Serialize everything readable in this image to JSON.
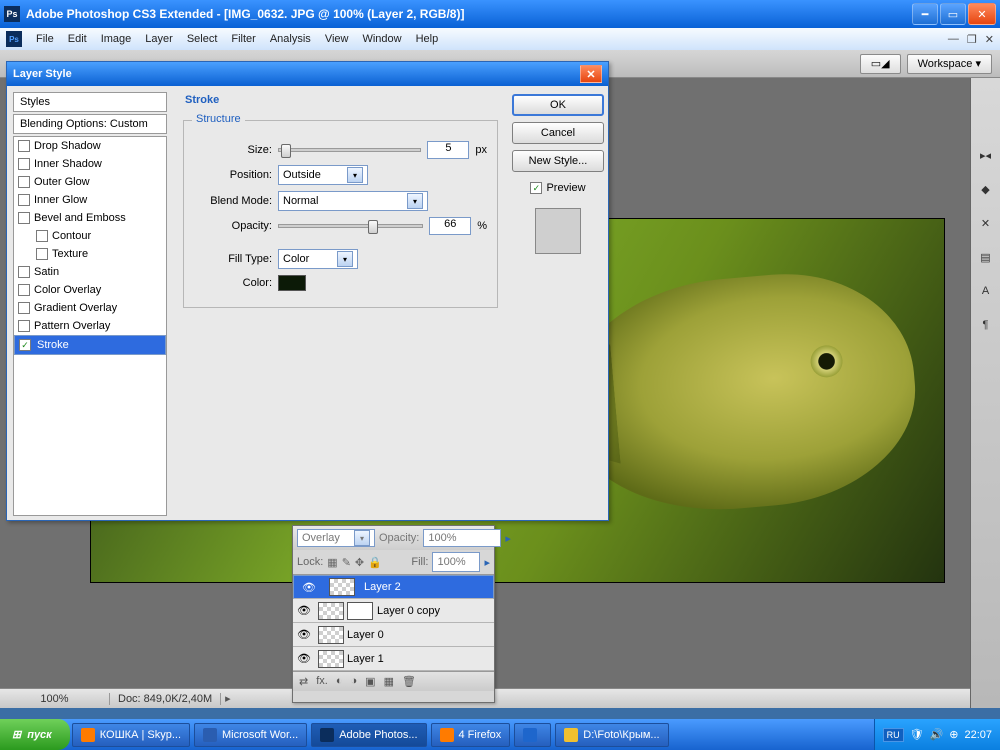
{
  "title": "Adobe Photoshop CS3 Extended - [IMG_0632. JPG @ 100% (Layer 2, RGB/8)]",
  "menu": [
    "File",
    "Edit",
    "Image",
    "Layer",
    "Select",
    "Filter",
    "Analysis",
    "View",
    "Window",
    "Help"
  ],
  "workspace_btn": "Workspace ▾",
  "dialog": {
    "title": "Layer Style",
    "styles_header": "Styles",
    "blending": "Blending Options: Custom",
    "items": [
      {
        "label": "Drop Shadow",
        "checked": false
      },
      {
        "label": "Inner Shadow",
        "checked": false
      },
      {
        "label": "Outer Glow",
        "checked": false
      },
      {
        "label": "Inner Glow",
        "checked": false
      },
      {
        "label": "Bevel and Emboss",
        "checked": false
      },
      {
        "label": "Contour",
        "checked": false,
        "indent": true
      },
      {
        "label": "Texture",
        "checked": false,
        "indent": true
      },
      {
        "label": "Satin",
        "checked": false
      },
      {
        "label": "Color Overlay",
        "checked": false
      },
      {
        "label": "Gradient Overlay",
        "checked": false
      },
      {
        "label": "Pattern Overlay",
        "checked": false
      },
      {
        "label": "Stroke",
        "checked": true,
        "selected": true
      }
    ],
    "panel_title": "Stroke",
    "structure": "Structure",
    "size_label": "Size:",
    "size_value": "5",
    "size_unit": "px",
    "position_label": "Position:",
    "position_value": "Outside",
    "blendmode_label": "Blend Mode:",
    "blendmode_value": "Normal",
    "opacity_label": "Opacity:",
    "opacity_value": "66",
    "opacity_unit": "%",
    "filltype_label": "Fill Type:",
    "filltype_value": "Color",
    "color_label": "Color:",
    "color_value": "#0c1a07",
    "ok": "OK",
    "cancel": "Cancel",
    "newstyle": "New Style...",
    "preview": "Preview"
  },
  "layers_panel": {
    "mode": "Overlay",
    "opacity_label": "Opacity:",
    "opacity": "100%",
    "lock_label": "Lock:",
    "fill_label": "Fill:",
    "fill": "100%",
    "layers": [
      {
        "name": "Layer 2",
        "selected": true,
        "mask": false,
        "thumb": "#bfbfbf"
      },
      {
        "name": "Layer 0 copy",
        "selected": false,
        "mask": true,
        "thumb": "#bfbfbf"
      },
      {
        "name": "Layer 0",
        "selected": false,
        "mask": false,
        "thumb": "#5a7a2a"
      },
      {
        "name": "Layer 1",
        "selected": false,
        "mask": false,
        "thumb": "#8fb667"
      }
    ]
  },
  "status": {
    "zoom": "100%",
    "doc": "Doc: 849,0K/2,40M"
  },
  "taskbar": {
    "start": "пуск",
    "tasks": [
      {
        "label": "КОШКА | Skyp...",
        "color": "#ff7b00"
      },
      {
        "label": "Microsoft Wor...",
        "color": "#2a5db0"
      },
      {
        "label": "Adobe Photos...",
        "color": "#0b2d5c",
        "active": true
      },
      {
        "label": "4 Firefox",
        "color": "#ff7b00"
      },
      {
        "label": "",
        "color": "#1e66cc"
      },
      {
        "label": "D:\\Foto\\Крым...",
        "color": "#f0c030"
      }
    ],
    "lang": "RU",
    "time": "22:07"
  }
}
